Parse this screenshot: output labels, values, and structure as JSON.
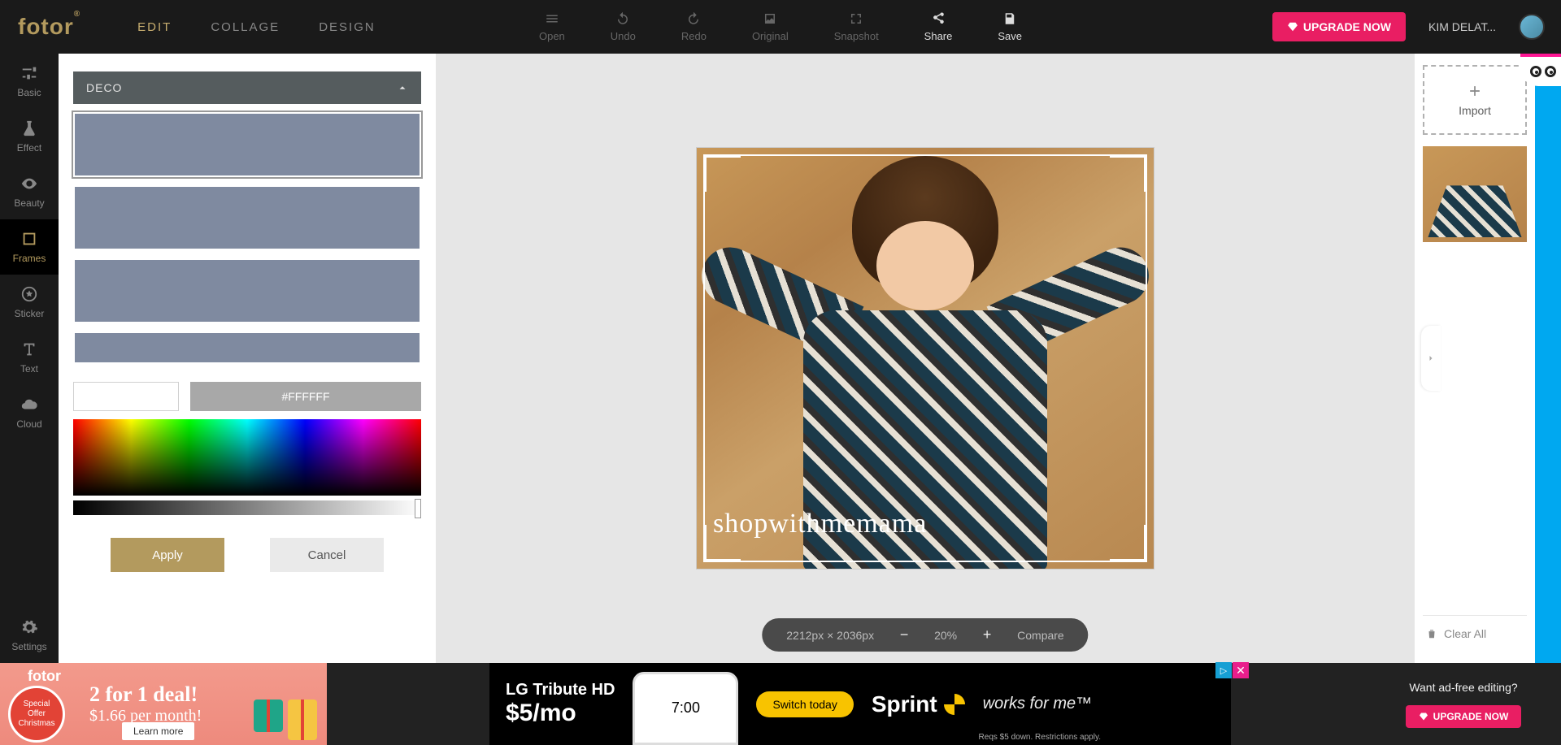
{
  "header": {
    "logo": "fotor",
    "modes": {
      "edit": "EDIT",
      "collage": "COLLAGE",
      "design": "DESIGN",
      "active": "edit"
    },
    "tools": {
      "open": "Open",
      "undo": "Undo",
      "redo": "Redo",
      "original": "Original",
      "snapshot": "Snapshot",
      "share": "Share",
      "save": "Save"
    },
    "upgrade": "UPGRADE NOW",
    "username": "KIM DELAT..."
  },
  "rail": {
    "basic": "Basic",
    "effect": "Effect",
    "beauty": "Beauty",
    "frames": "Frames",
    "sticker": "Sticker",
    "text": "Text",
    "cloud": "Cloud",
    "settings": "Settings",
    "active": "frames"
  },
  "panel": {
    "category": "DECO",
    "hex": "#FFFFFF",
    "apply": "Apply",
    "cancel": "Cancel"
  },
  "canvas": {
    "watermark": "shopwithmemama",
    "dimensions": "2212px × 2036px",
    "zoom": "20%",
    "compare": "Compare"
  },
  "right": {
    "import": "Import",
    "clear": "Clear All"
  },
  "promo": {
    "brand": "fotor",
    "badge1": "Special",
    "badge2": "Offer",
    "badge3": "Christmas",
    "line1": "2 for 1 deal!",
    "line2": "$1.66 per month!",
    "learn": "Learn more"
  },
  "ad": {
    "title": "LG Tribute HD",
    "price": "$5/mo",
    "switch": "Switch today",
    "brand": "Sprint",
    "works": "works for me™",
    "fine": "Reqs $5 down. Restrictions apply."
  },
  "footer": {
    "question": "Want ad-free editing?",
    "upgrade": "UPGRADE NOW"
  }
}
